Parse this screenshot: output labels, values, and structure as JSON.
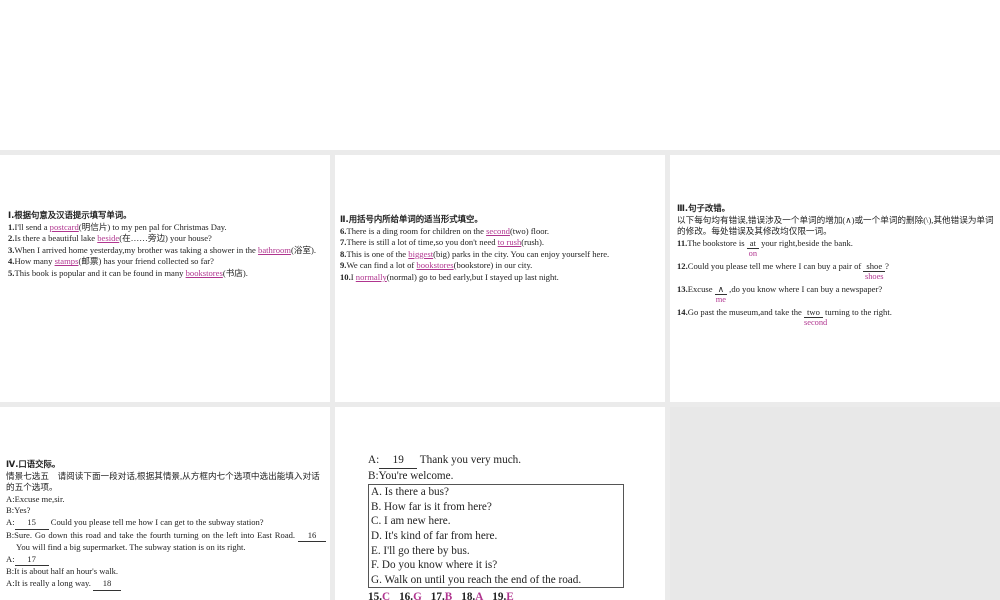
{
  "section1": {
    "heading": "Ⅰ.根据句意及汉语提示填写单词。",
    "items": [
      {
        "num": "1.",
        "pre": "I'll send a ",
        "ans": "postcard",
        "post": "(明信片) to my pen pal for Christmas Day."
      },
      {
        "num": "2.",
        "pre": "Is there a beautiful lake ",
        "ans": "beside",
        "post": "(在……旁边) your house?"
      },
      {
        "num": "3.",
        "pre": "When I arrived home yesterday,my brother was taking a shower in the ",
        "ans": "bathroom",
        "post": "(浴室)."
      },
      {
        "num": "4.",
        "pre": "How many ",
        "ans": "stamps",
        "post": "(邮票) has your friend collected so far?"
      },
      {
        "num": "5.",
        "pre": "This book is popular and it can be found in many ",
        "ans": "bookstores",
        "post": "(书店)."
      }
    ]
  },
  "section2": {
    "heading": "Ⅱ.用括号内所给单词的适当形式填空。",
    "items": [
      {
        "num": "6.",
        "pre": "There is a ding room for children on the ",
        "ans": "second",
        "post": "(two) floor."
      },
      {
        "num": "7.",
        "pre": "There is still a lot of time,so you don't need ",
        "ans": "to rush",
        "post": "(rush)."
      },
      {
        "num": "8.",
        "pre": "This is one of the ",
        "ans": "biggest",
        "post": "(big) parks in the city. You can enjoy yourself here."
      },
      {
        "num": "9.",
        "pre": "We can find a lot of ",
        "ans": "bookstores",
        "post": "(bookstore) in our city."
      },
      {
        "num": "10.",
        "pre": "I ",
        "ans": "normally",
        "post": "(normal) go to bed early,but I stayed up last night."
      }
    ]
  },
  "section3": {
    "heading": "Ⅲ.句子改错。",
    "instructions": "以下每句均有错误,错误涉及一个单词的增加(∧)或一个单词的删除(\\),其他错误为单词的修改。每处错误及其修改均仅限一词。",
    "items": [
      {
        "num": "11.",
        "pre": "The bookstore is ",
        "wrong": "at",
        "fix": "on",
        "post": " your right,beside the bank."
      },
      {
        "num": "12.",
        "pre": "Could you please tell me where I can buy a pair of ",
        "wrong": "shoe",
        "fix": "shoes",
        "post": "?"
      },
      {
        "num": "13.",
        "pre": "Excuse ",
        "wrong": "∧",
        "fix": "me",
        "post": " ,do you know where I can buy a newspaper?"
      },
      {
        "num": "14.",
        "pre": "Go past the museum,and take the ",
        "wrong": "two",
        "fix": "second",
        "post": " turning to the right."
      }
    ]
  },
  "section4": {
    "heading": "Ⅳ.口语交际。",
    "instructions": "情景七选五　请阅读下面一段对话,根据其情景,从方框内七个选项中选出能填入对话的五个选项。",
    "l1": "A:Excuse me,sir.",
    "l2": "B:Yes?",
    "l3a": "A:",
    "b15": "15",
    "l3b": " Could you please tell me how I can get to the subway station?",
    "l4a": "B:Sure. Go down this road and take the fourth turning on the left into East Road. ",
    "b16": "16",
    "l4b": " You will find a big supermarket. The subway station is on its right.",
    "l5a": "A:",
    "b17": "17",
    "l6": "B:It is about half an hour's walk.",
    "l7a": "A:It is really a long way. ",
    "b18": "18"
  },
  "section5": {
    "l1a": "A:",
    "b19": "19",
    "l1b": " Thank you very much.",
    "l2": "B:You're welcome.",
    "options": [
      "A. Is there a bus?",
      "B. How far is it from here?",
      "C. I am new here.",
      "D. It's kind of far from here.",
      "E. I'll go there by bus.",
      "F. Do you know where it is?",
      "G. Walk on until you reach the end of the road."
    ],
    "answers": [
      {
        "num": "15.",
        "ans": "C"
      },
      {
        "num": "16.",
        "ans": "G"
      },
      {
        "num": "17.",
        "ans": "B"
      },
      {
        "num": "18.",
        "ans": "A"
      },
      {
        "num": "19.",
        "ans": "E"
      }
    ]
  }
}
